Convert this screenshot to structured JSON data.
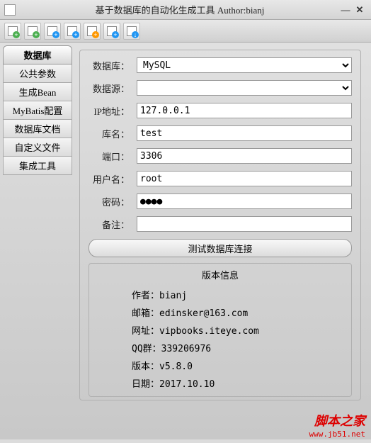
{
  "titlebar": {
    "title": "基于数据库的自动化生成工具 Author:bianj"
  },
  "sidebar": {
    "header": "数据库",
    "items": [
      "公共参数",
      "生成Bean",
      "MyBatis配置",
      "数据库文档",
      "自定义文件",
      "集成工具"
    ]
  },
  "form": {
    "labels": {
      "database": "数据库：",
      "datasource": "数据源：",
      "ip": "IP地址：",
      "dbname": "库名：",
      "port": "端口：",
      "user": "用户名：",
      "password": "密码：",
      "remark": "备注："
    },
    "values": {
      "database": "MySQL",
      "datasource": "",
      "ip": "127.0.0.1",
      "dbname": "test",
      "port": "3306",
      "user": "root",
      "password": "●●●●",
      "remark": ""
    },
    "test_btn": "测试数据库连接"
  },
  "info": {
    "header": "版本信息",
    "rows": [
      "作者：bianj",
      "邮箱：edinsker@163.com",
      "网址：vipbooks.iteye.com",
      "QQ群：339206976",
      "版本：v5.8.0",
      "日期：2017.10.10"
    ]
  },
  "watermark": {
    "line1": "脚本之家",
    "line2": "www.jb51.net"
  },
  "toolbar_colors": [
    "#4caf50",
    "#4caf50",
    "#2196f3",
    "#2196f3",
    "#ff9800",
    "#ff9800",
    "#2196f3"
  ]
}
